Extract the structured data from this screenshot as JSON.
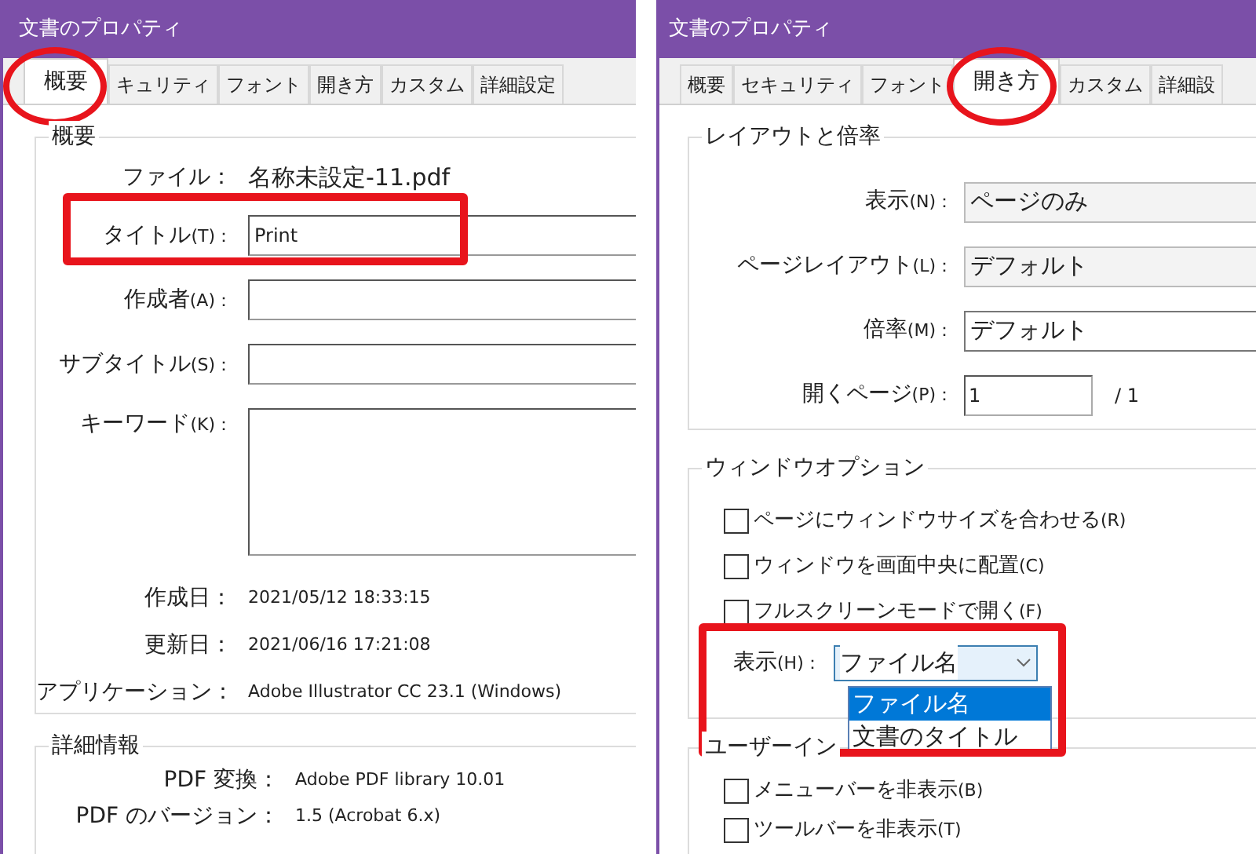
{
  "left": {
    "title": "文書のプロパティ",
    "tabs": [
      {
        "label": "概要",
        "selected": true
      },
      {
        "label": "キュリティ",
        "selected": false
      },
      {
        "label": "フォント",
        "selected": false
      },
      {
        "label": "開き方",
        "selected": false
      },
      {
        "label": "カスタム",
        "selected": false
      },
      {
        "label": "詳細設定",
        "selected": false
      }
    ],
    "summary": {
      "legend": "概要",
      "rows": [
        {
          "kind": "text",
          "label": "ファイル：",
          "value": "名称未設定-11.pdf"
        },
        {
          "kind": "field",
          "label": "タイトル",
          "key": "(T)：",
          "value": "Print"
        },
        {
          "kind": "field",
          "label": "作成者",
          "key": "(A)："
        },
        {
          "kind": "field",
          "label": "サブタイトル",
          "key": "(S)："
        },
        {
          "kind": "area",
          "label": "キーワード",
          "key": "(K)："
        },
        {
          "kind": "info",
          "label": "作成日：",
          "value": "2021/05/12 18:33:15"
        },
        {
          "kind": "info",
          "label": "更新日：",
          "value": "2021/06/16 17:21:08"
        },
        {
          "kind": "info",
          "label": "アプリケーション：",
          "value": "Adobe Illustrator CC 23.1 (Windows)"
        }
      ]
    },
    "details": {
      "legend": "詳細情報",
      "rows": [
        {
          "label": "PDF 変換：",
          "value": "Adobe PDF library 10.01"
        },
        {
          "label": "PDF のバージョン：",
          "value": "1.5 (Acrobat 6.x)"
        }
      ]
    }
  },
  "right": {
    "title": "文書のプロパティ",
    "tabs": [
      {
        "label": "概要",
        "selected": false
      },
      {
        "label": "セキュリティ",
        "selected": false
      },
      {
        "label": "フォント",
        "selected": false
      },
      {
        "label": "開き方",
        "selected": true
      },
      {
        "label": "カスタム",
        "selected": false
      },
      {
        "label": "詳細設",
        "selected": false
      }
    ],
    "layout": {
      "legend": "レイアウトと倍率",
      "rows": [
        {
          "kind": "select",
          "label": "表示",
          "key": "(N)：",
          "value": "ページのみ"
        },
        {
          "kind": "select",
          "label": "ページレイアウト",
          "key": "(L)：",
          "value": "デフォルト"
        },
        {
          "kind": "combo",
          "label": "倍率",
          "key": "(M)：",
          "value": "デフォルト"
        },
        {
          "kind": "page",
          "label": "開くページ",
          "key": "(P)：",
          "value": "1",
          "suffix": "/ 1"
        }
      ]
    },
    "window_options": {
      "legend": "ウィンドウオプション",
      "checkboxes": [
        {
          "label": "ページにウィンドウサイズを合わせる",
          "key": "(R)",
          "checked": false
        },
        {
          "label": "ウィンドウを画面中央に配置",
          "key": "(C)",
          "checked": false
        },
        {
          "label": "フルスクリーンモードで開く",
          "key": "(F)",
          "checked": false
        }
      ],
      "display": {
        "label": "表示",
        "key": "(H)：",
        "value": "ファイル名",
        "expanded": true,
        "options": [
          {
            "label": "ファイル名",
            "selected": true
          },
          {
            "label": "文書のタイトル",
            "selected": false
          }
        ]
      }
    },
    "ui_options": {
      "legend": "ユーザーイン",
      "checkboxes": [
        {
          "label": "メニューバーを非表示",
          "key": "(B)",
          "checked": false
        },
        {
          "label": "ツールバーを非表示",
          "key": "(T)",
          "checked": false
        }
      ]
    }
  }
}
